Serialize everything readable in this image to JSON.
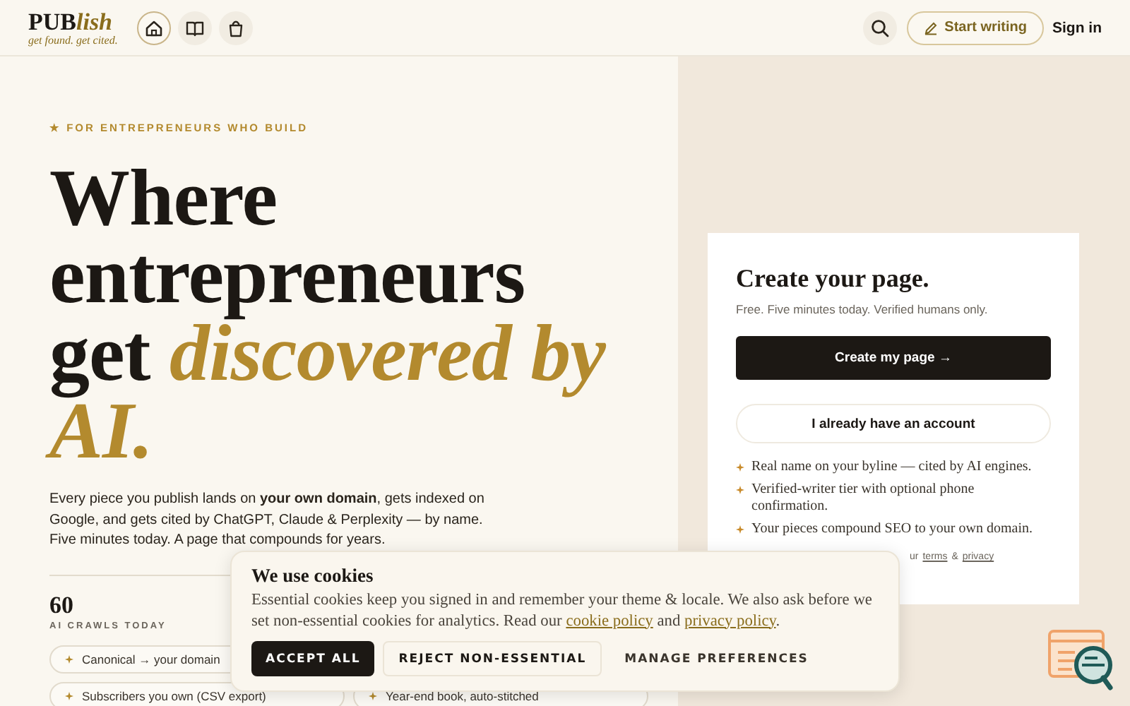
{
  "header": {
    "logo": {
      "main": "PUB",
      "accent": "lish"
    },
    "tagline": "get found. get cited.",
    "nav": [
      {
        "kind": "home",
        "selected": true
      },
      {
        "kind": "book",
        "selected": false
      },
      {
        "kind": "bag",
        "selected": false
      }
    ],
    "start_writing": "Start writing",
    "sign_in": "Sign in"
  },
  "hero": {
    "eyebrow": "★ FOR ENTREPRENEURS WHO BUILD",
    "headline": "Where entrepreneurs get *discovered by AI.*",
    "intro": "Every piece you publish lands on **your own domain**, gets indexed on Google, and gets cited by ChatGPT, Claude & Perplexity — by name. Five minutes today. A page that compounds for years.",
    "stat": {
      "value": "60",
      "label": "AI CRAWLS TODAY"
    },
    "features": [
      "Canonical → your domain",
      "Subscribers you own (CSV export)",
      "Year-end book, auto-stitched"
    ]
  },
  "signup": {
    "title": "Create your page.",
    "subtitle": "Free. Five minutes today. Verified humans only.",
    "primary": "Create my page →",
    "secondary": "I already have an account",
    "benefits": [
      "Real name on your byline — cited by AI engines.",
      "Verified-writer tier with optional phone confirmation.",
      "Your pieces compound SEO to your own domain."
    ],
    "legal": {
      "before": "ur",
      "terms": "terms",
      "between": "&",
      "privacy": "privacy"
    }
  },
  "cookie_banner": {
    "title": "We use cookies",
    "text_before": "Essential cookies keep you signed in and remember your theme & locale. We also ask before we set non-essential cookies for analytics. Read our",
    "cookie_link": "cookie policy",
    "text_between": "and",
    "privacy_link": "privacy policy",
    "text_after": ".",
    "buttons": [
      {
        "kind": "primary",
        "label": "ACCEPT ALL"
      },
      {
        "kind": "outline",
        "label": "REJECT NON-ESSENTIAL"
      },
      {
        "kind": "plain",
        "label": "MANAGE PREFERENCES"
      }
    ]
  }
}
